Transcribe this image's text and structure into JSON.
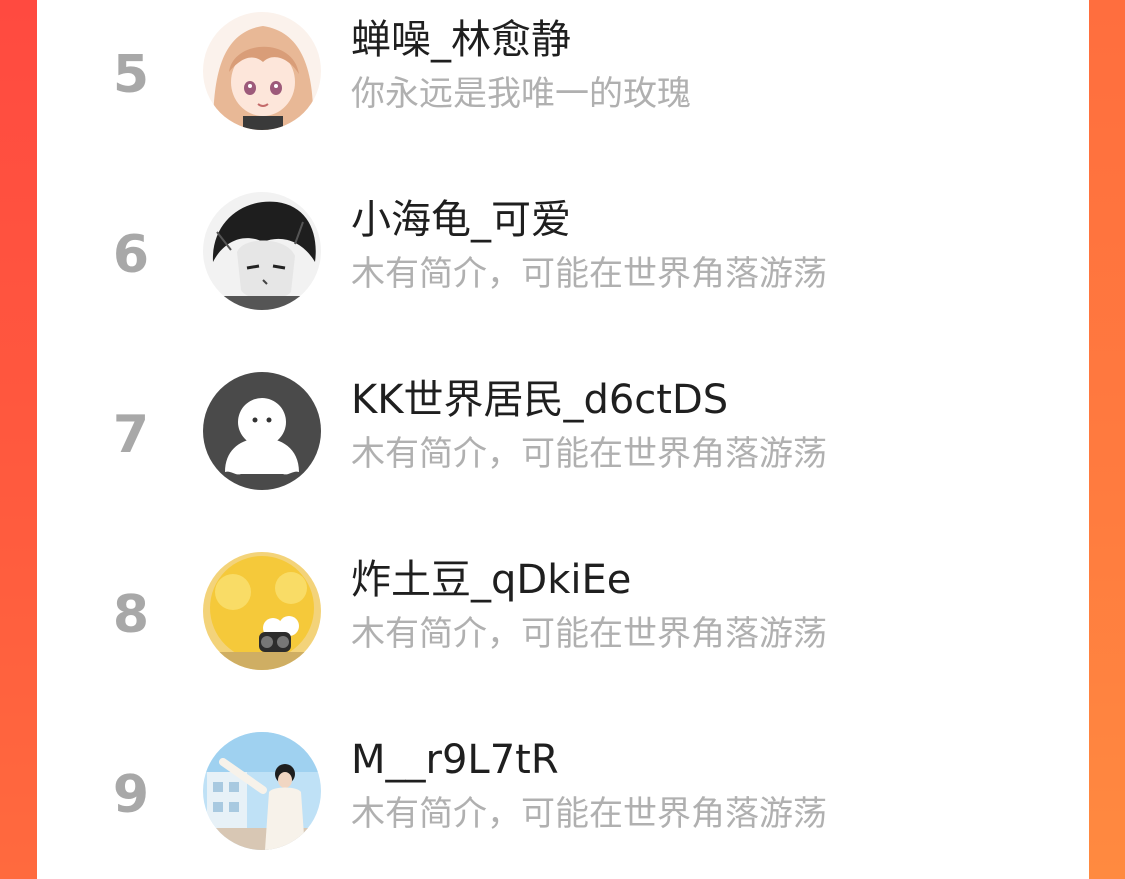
{
  "colors": {
    "accent_left": "#ff4a40",
    "accent_right": "#ff8a40",
    "rank_color": "#a8a8a8",
    "name_color": "#1f1f1f",
    "bio_color": "#b0b0b0"
  },
  "ranking": {
    "items": [
      {
        "rank": "5",
        "name": "蝉噪_林愈静",
        "bio": "你永远是我唯一的玫瑰",
        "avatar": "anime-girl-avatar"
      },
      {
        "rank": "6",
        "name": "小海龟_可爱",
        "bio": "木有简介，可能在世界角落游荡",
        "avatar": "manga-boy-avatar"
      },
      {
        "rank": "7",
        "name": "KK世界居民_d6ctDS",
        "bio": "木有简介，可能在世界角落游荡",
        "avatar": "default-ghost-avatar"
      },
      {
        "rank": "8",
        "name": "炸土豆_qDkiEe",
        "bio": "木有简介，可能在世界角落游荡",
        "avatar": "yellow-duck-avatar"
      },
      {
        "rank": "9",
        "name": "M__r9L7tR",
        "bio": "木有简介，可能在世界角落游荡",
        "avatar": "selfie-photo-avatar"
      }
    ]
  }
}
